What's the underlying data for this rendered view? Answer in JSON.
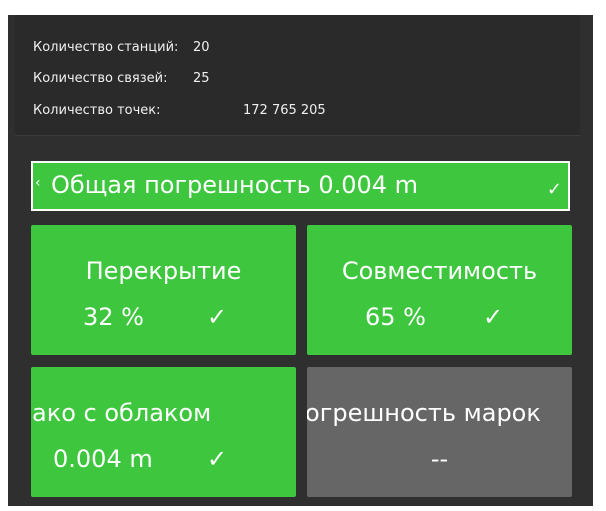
{
  "stats": {
    "stations_label": "Количество станций:",
    "stations_value": "20",
    "links_label": "Количество связей:",
    "links_value": "25",
    "points_label": "Количество точек:",
    "points_value": "172 765 205"
  },
  "total_error": {
    "label": "Общая погрешность 0.004 m",
    "check": "✓",
    "status": "ok"
  },
  "tiles": [
    {
      "title": "Перекрытие",
      "value": "32 %",
      "check": "✓",
      "status": "ok"
    },
    {
      "title": "Совместимость",
      "value": "65 %",
      "check": "✓",
      "status": "ok"
    },
    {
      "title": "Облако с облаком",
      "value": "0.004 m",
      "check": "✓",
      "status": "ok"
    },
    {
      "title": "Погрешность марок",
      "value": "--",
      "check": "",
      "status": "none"
    }
  ],
  "colors": {
    "ok": "#3ec63e",
    "none": "#666666",
    "panel": "#2f2f2f"
  }
}
